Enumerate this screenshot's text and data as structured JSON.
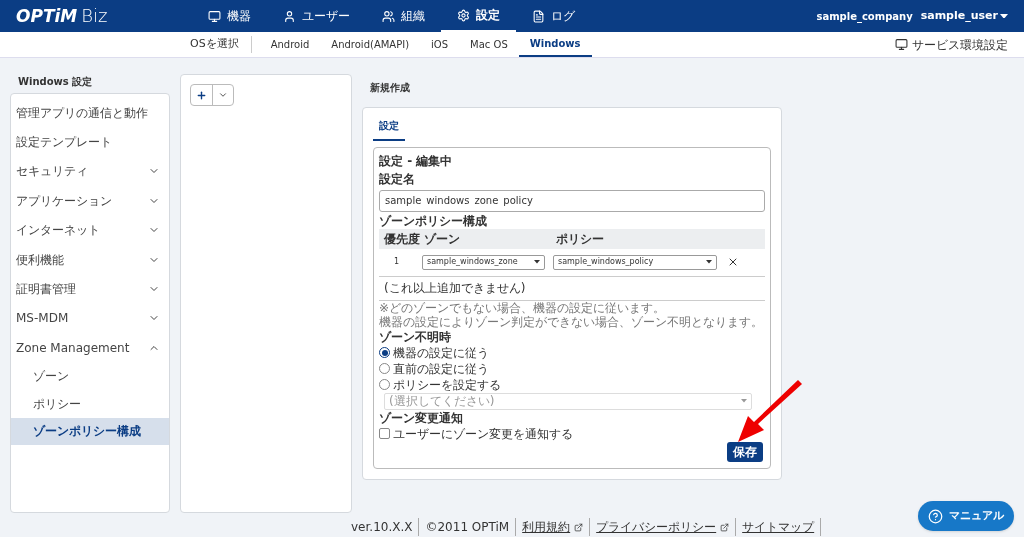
{
  "header": {
    "logo": "OPTiM",
    "logo_suffix": "Biz",
    "nav": [
      {
        "label": "機器",
        "selected": false
      },
      {
        "label": "ユーザー",
        "selected": false
      },
      {
        "label": "組織",
        "selected": false
      },
      {
        "label": "設定",
        "selected": true
      },
      {
        "label": "ログ",
        "selected": false
      }
    ],
    "company": "sample_company",
    "user": "sample_user"
  },
  "os_bar": {
    "label": "OSを選択",
    "tabs": [
      {
        "label": "Android",
        "selected": false
      },
      {
        "label": "Android(AMAPI)",
        "selected": false
      },
      {
        "label": "iOS",
        "selected": false
      },
      {
        "label": "Mac OS",
        "selected": false
      },
      {
        "label": "Windows",
        "selected": true
      }
    ],
    "service_settings": "サービス環境設定"
  },
  "sidebar": {
    "title": "Windows 設定",
    "items": [
      {
        "label": "管理アプリの通信と動作",
        "expandable": false
      },
      {
        "label": "設定テンプレート",
        "expandable": false
      },
      {
        "label": "セキュリティ",
        "expandable": true,
        "expanded": false
      },
      {
        "label": "アプリケーション",
        "expandable": true,
        "expanded": false
      },
      {
        "label": "インターネット",
        "expandable": true,
        "expanded": false
      },
      {
        "label": "便利機能",
        "expandable": true,
        "expanded": false
      },
      {
        "label": "証明書管理",
        "expandable": true,
        "expanded": false
      },
      {
        "label": "MS-MDM",
        "expandable": true,
        "expanded": false
      },
      {
        "label": "Zone Management",
        "expandable": true,
        "expanded": true,
        "children": [
          {
            "label": "ゾーン",
            "selected": false
          },
          {
            "label": "ポリシー",
            "selected": false
          },
          {
            "label": "ゾーンポリシー構成",
            "selected": true
          }
        ]
      }
    ]
  },
  "main": {
    "title": "新規作成",
    "tabs": [
      {
        "label": "設定",
        "selected": true
      }
    ],
    "form": {
      "title": "設定 - 編集中",
      "name_label": "設定名",
      "name_value": "sample_windows_zone_policy",
      "composition_label": "ゾーンポリシー構成",
      "columns": [
        "優先度",
        "ゾーン",
        "ポリシー"
      ],
      "rows": [
        {
          "priority": "1",
          "zone": "sample_windows_zone",
          "policy": "sample_windows_policy"
        }
      ],
      "no_more": "(これ以上追加できません)",
      "notes": [
        "※どのゾーンでもない場合、機器の設定に従います。",
        "機器の設定によりゾーン判定ができない場合、ゾーン不明となります。"
      ],
      "unknown_label": "ゾーン不明時",
      "unknown_options": [
        {
          "label": "機器の設定に従う",
          "selected": true
        },
        {
          "label": "直前の設定に従う",
          "selected": false
        },
        {
          "label": "ポリシーを設定する",
          "selected": false
        }
      ],
      "policy_placeholder": "(選択してください)",
      "notify_label": "ゾーン変更通知",
      "notify_option": {
        "label": "ユーザーにゾーン変更を通知する",
        "checked": false
      },
      "save": "保存"
    }
  },
  "footer": {
    "items": [
      {
        "label": "ver.10.X.X",
        "link": false,
        "external": false
      },
      {
        "label": "©2011 OPTiM",
        "link": false,
        "external": false
      },
      {
        "label": "利用規約",
        "link": true,
        "external": true
      },
      {
        "label": "プライバシーポリシー",
        "link": true,
        "external": true
      },
      {
        "label": "サイトマップ",
        "link": true,
        "external": false
      }
    ]
  },
  "manual_button": "マニュアル"
}
